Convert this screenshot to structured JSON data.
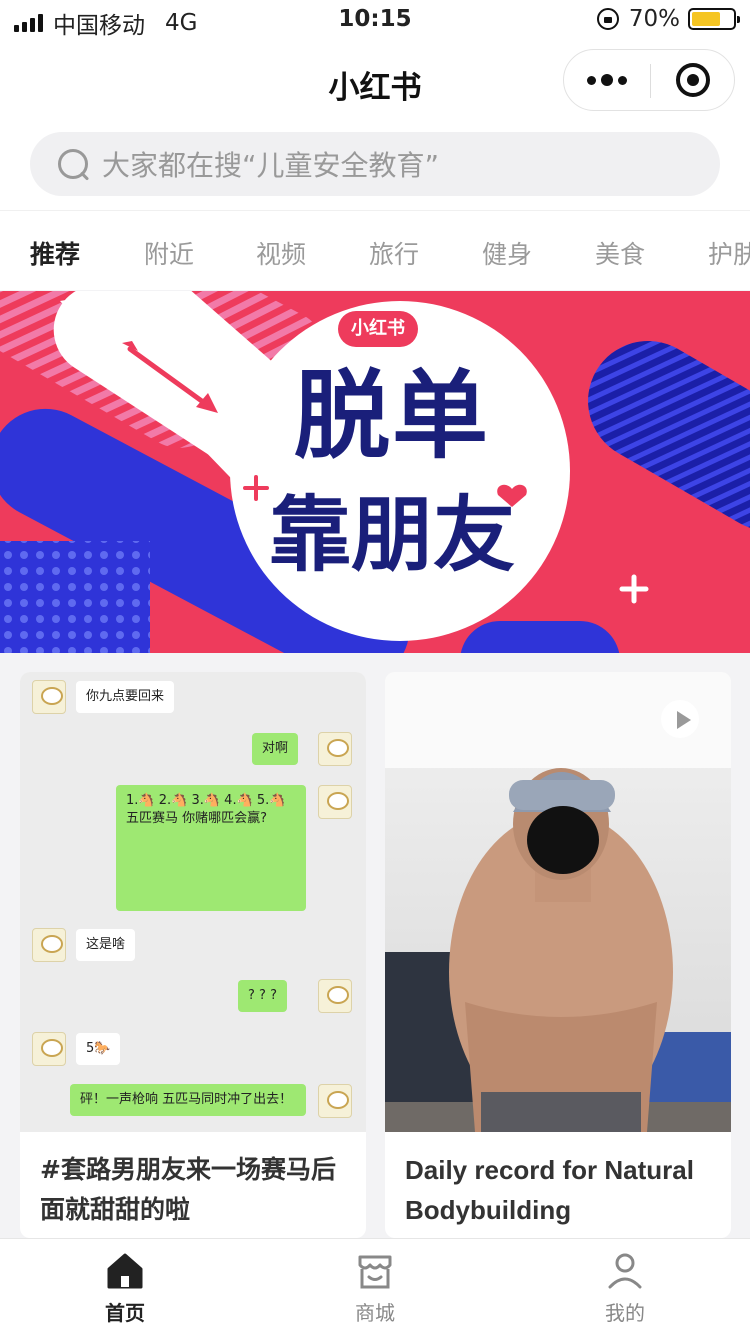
{
  "status_bar": {
    "carrier": "中国移动",
    "network": "4G",
    "time": "10:15",
    "battery": "70%",
    "battery_level": 0.7
  },
  "nav": {
    "title": "小红书",
    "more_icon": "more-dots-icon",
    "close_icon": "target-close-icon"
  },
  "search": {
    "placeholder": "大家都在搜“儿童安全教育”"
  },
  "tabs": [
    "推荐",
    "附近",
    "视频",
    "旅行",
    "健身",
    "美食",
    "护肤"
  ],
  "active_tab": 0,
  "banner": {
    "badge": "小红书",
    "headline_line1": "脱单",
    "headline_line2": "靠朋友"
  },
  "feed": [
    {
      "title": "#套路男朋友来一场赛马后面就甜甜的啦",
      "chat": [
        {
          "side": "in",
          "text": "你九点要回来"
        },
        {
          "side": "out",
          "text": "对啊"
        },
        {
          "side": "out",
          "text": "1.🐴 2.🐴 3.🐴 4.🐴 5.🐴 五匹赛马 你赌哪匹会赢?"
        },
        {
          "side": "in",
          "text": "这是啥"
        },
        {
          "side": "out",
          "text": "? ? ?"
        },
        {
          "side": "in",
          "text": "5🐎"
        },
        {
          "side": "out",
          "text": "砰！一声枪响 五匹马同时冲了出去！"
        }
      ]
    },
    {
      "title": "Daily record for Natural Bodybuilding",
      "media": "video",
      "play_icon": "play-icon"
    }
  ],
  "tab_bar": [
    {
      "label": "首页",
      "icon": "home-icon",
      "active": true
    },
    {
      "label": "商城",
      "icon": "store-icon",
      "active": false
    },
    {
      "label": "我的",
      "icon": "user-icon",
      "active": false
    }
  ],
  "colors": {
    "brand_red": "#ee3b5c",
    "banner_blue": "#2f34d8",
    "headline_navy": "#1a1f7a",
    "chat_green": "#9ee872",
    "battery_yellow": "#f5c523"
  }
}
